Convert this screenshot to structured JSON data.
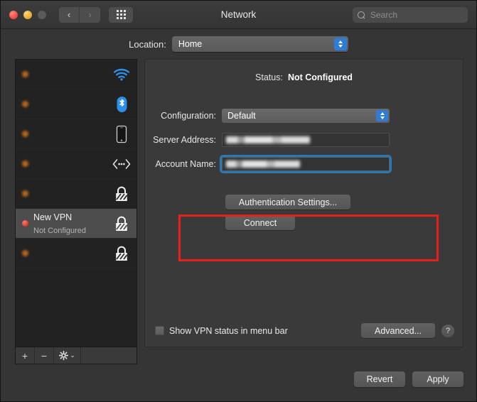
{
  "window": {
    "title": "Network",
    "traffic_lights": [
      "close-red",
      "minimize-yellow",
      "zoom-gray-disabled"
    ],
    "nav_back": "‹",
    "nav_forward": "›",
    "grid_button": "show-all-icon"
  },
  "search": {
    "placeholder": "Search",
    "value": "",
    "icon": "search-icon"
  },
  "location": {
    "label": "Location:",
    "value": "Home"
  },
  "sidebar": {
    "services": [
      {
        "name": "",
        "sub": "",
        "redacted": true,
        "icon": "wifi-icon",
        "dot": "orange",
        "selected": false
      },
      {
        "name": "",
        "sub": "",
        "redacted": true,
        "icon": "bluetooth-icon",
        "dot": "orange",
        "selected": false
      },
      {
        "name": "",
        "sub": "",
        "redacted": true,
        "icon": "iphone-icon",
        "dot": "orange",
        "selected": false
      },
      {
        "name": "",
        "sub": "",
        "redacted": true,
        "icon": "thunderbolt-icon",
        "dot": "orange",
        "selected": false
      },
      {
        "name": "",
        "sub": "",
        "redacted": true,
        "icon": "vpn-lock-icon",
        "dot": "orange",
        "selected": false
      },
      {
        "name": "New VPN",
        "sub": "Not Configured",
        "redacted": false,
        "icon": "vpn-lock-icon",
        "dot": "red",
        "selected": true
      },
      {
        "name": "",
        "sub": "",
        "redacted": true,
        "icon": "vpn-lock-icon",
        "dot": "orange",
        "selected": false
      }
    ],
    "toolbar": {
      "add": "+",
      "remove": "−",
      "actions": "gear-icon",
      "actions_chevron": "⌄"
    }
  },
  "detail": {
    "status_label": "Status:",
    "status_value": "Not Configured",
    "configuration_label": "Configuration:",
    "configuration_value": "Default",
    "server_address_label": "Server Address:",
    "server_address_value": "",
    "account_name_label": "Account Name:",
    "account_name_value": "",
    "account_name_focused": true,
    "auth_settings_button": "Authentication Settings...",
    "connect_button": "Connect",
    "show_vpn_status_label": "Show VPN status in menu bar",
    "show_vpn_status_checked": false,
    "advanced_button": "Advanced...",
    "help_button": "?"
  },
  "footer": {
    "revert_button": "Revert",
    "apply_button": "Apply"
  },
  "colors": {
    "accent_blue": "#2f7cd6",
    "focus_ring": "#2b78b6",
    "annotation_red": "#e81f1a",
    "status_dot_red": "#d93b2e",
    "window_bg": "#353535",
    "panel_bg": "#3a3a3a",
    "list_bg": "#222222"
  }
}
